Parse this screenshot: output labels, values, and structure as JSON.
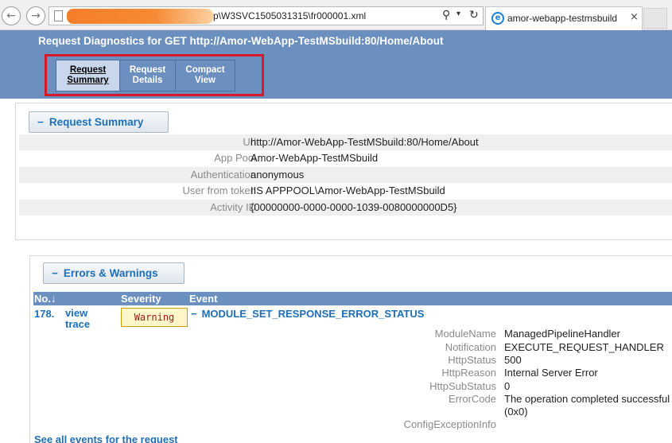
{
  "browser": {
    "address_text": "p\\W3SVC1505031315\\fr000001.xml",
    "tab_title": "amor-webapp-testmsbuild",
    "tab_close": "×",
    "back_glyph": "←",
    "forward_glyph": "→",
    "search_glyph": "⚲",
    "dropdown_glyph": "▾",
    "refresh_glyph": "↻",
    "ie_glyph": "e"
  },
  "header": {
    "title": "Request Diagnostics for GET http://Amor-WebApp-TestMSbuild:80/Home/About",
    "tabs": [
      {
        "line1": "Request",
        "line2": "Summary"
      },
      {
        "line1": "Request",
        "line2": "Details"
      },
      {
        "line1": "Compact",
        "line2": "View"
      }
    ],
    "colors": {
      "header_bg": "#6b8fbf",
      "highlight_box": "#d9172a"
    }
  },
  "summary": {
    "section_label": "Request Summary",
    "toggle_glyph": "−",
    "rows": [
      {
        "key": "Url",
        "value": "http://Amor-WebApp-TestMSbuild:80/Home/About"
      },
      {
        "key": "App Pool",
        "value": "Amor-WebApp-TestMSbuild"
      },
      {
        "key": "Authentication",
        "value": "anonymous"
      },
      {
        "key": "User from token",
        "value": "IIS APPPOOL\\Amor-WebApp-TestMSbuild"
      },
      {
        "key": "Activity ID",
        "value": "{00000000-0000-0000-1039-0080000000D5}"
      }
    ]
  },
  "errors": {
    "section_label": "Errors & Warnings",
    "toggle_glyph": "−",
    "columns": {
      "no": "No.↓",
      "severity": "Severity",
      "event": "Event"
    },
    "event": {
      "number": "178.",
      "link_line1": "view",
      "link_line2": "trace",
      "severity": "Warning",
      "name": "MODULE_SET_RESPONSE_ERROR_STATUS",
      "details": [
        {
          "key": "ModuleName",
          "value": "ManagedPipelineHandler"
        },
        {
          "key": "Notification",
          "value": "EXECUTE_REQUEST_HANDLER"
        },
        {
          "key": "HttpStatus",
          "value": "500"
        },
        {
          "key": "HttpReason",
          "value": "Internal Server Error"
        },
        {
          "key": "HttpSubStatus",
          "value": "0"
        },
        {
          "key": "ErrorCode",
          "value": "The operation completed successful"
        },
        {
          "key": "",
          "value": " (0x0)"
        },
        {
          "key": "ConfigExceptionInfo",
          "value": ""
        }
      ]
    },
    "see_all": "See all events for the request"
  }
}
